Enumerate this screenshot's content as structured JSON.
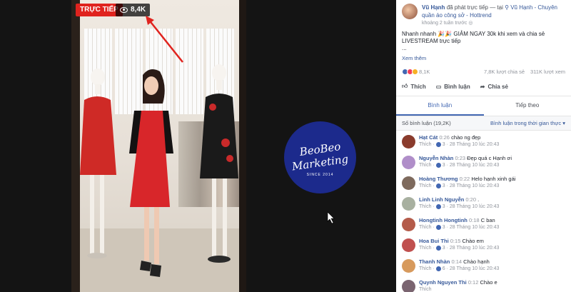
{
  "stream": {
    "live_label": "TRỰC TIẾP",
    "view_count": "8,4K"
  },
  "logo": {
    "line1": "BeoBeo",
    "line2": "Marketing",
    "line3": "SINCE 2014"
  },
  "post": {
    "author": "Vũ Hạnh",
    "action": "đã phát trực tiếp — tại",
    "location": "Vũ Hạnh - Chuyên quần áo công sở - Hottrend",
    "time": "khoảng 2 tuần trước",
    "caption": "Nhanh nhanh 🎉🎉 GIẢM NGAY 30k khi xem và chia sẻ LIVESTREAM trực tiếp",
    "ellipsis": "...",
    "see_more": "Xem thêm",
    "reactions_count": "8,1K",
    "shares": "7,8K lượt chia sẻ",
    "views": "311K lượt xem",
    "like_label": "Thích",
    "comment_label": "Bình luận",
    "share_label": "Chia sẻ"
  },
  "tabs": {
    "comments": "Bình luận",
    "up_next": "Tiếp theo"
  },
  "comment_bar": {
    "count": "Số bình luận (19,2K)",
    "sort": "Bình luận trong thời gian thực"
  },
  "comments": [
    {
      "author": "Hạt Cát",
      "time": "0:26",
      "text": "chào ng đẹp",
      "likes": "3",
      "date": "28 Tháng 10 lúc 20:43",
      "color": "#8a3b2c"
    },
    {
      "author": "Nguyễn Nhàn",
      "time": "0:23",
      "text": "Đẹp quá c Hạnh ơi",
      "likes": "3",
      "date": "28 Tháng 10 lúc 20:43",
      "color": "#b08ec9"
    },
    {
      "author": "Hoàng Thương",
      "time": "0:22",
      "text": "Helo hạnh xinh gái",
      "likes": "3",
      "date": "28 Tháng 10 lúc 20:43",
      "color": "#7e6a5d"
    },
    {
      "author": "Linh Linh Nguyễn",
      "time": "0:20",
      "text": ".",
      "likes": "3",
      "date": "28 Tháng 10 lúc 20:43",
      "color": "#a8b0a0"
    },
    {
      "author": "Hongtinh Hongtinh",
      "time": "0:18",
      "text": "C ban",
      "likes": "3",
      "date": "28 Tháng 10 lúc 20:43",
      "color": "#b45b4a"
    },
    {
      "author": "Hoa Bui Thi",
      "time": "0:15",
      "text": "Chào em",
      "likes": "3",
      "date": "28 Tháng 10 lúc 20:43",
      "color": "#c0504f"
    },
    {
      "author": "Thanh Nhàn",
      "time": "0:14",
      "text": "Chào hạnh",
      "likes": "6",
      "date": "28 Tháng 10 lúc 20:43",
      "color": "#d79a5d"
    },
    {
      "author": "Quynh Nguyen Thi",
      "time": "0:12",
      "text": "Chào e",
      "likes": "",
      "date": "",
      "color": "#7a6470"
    }
  ],
  "colors": {
    "live_red": "#e0231e",
    "link_blue": "#365899",
    "accent_blue": "#4267b2",
    "logo_blue": "#1c2a8c"
  }
}
